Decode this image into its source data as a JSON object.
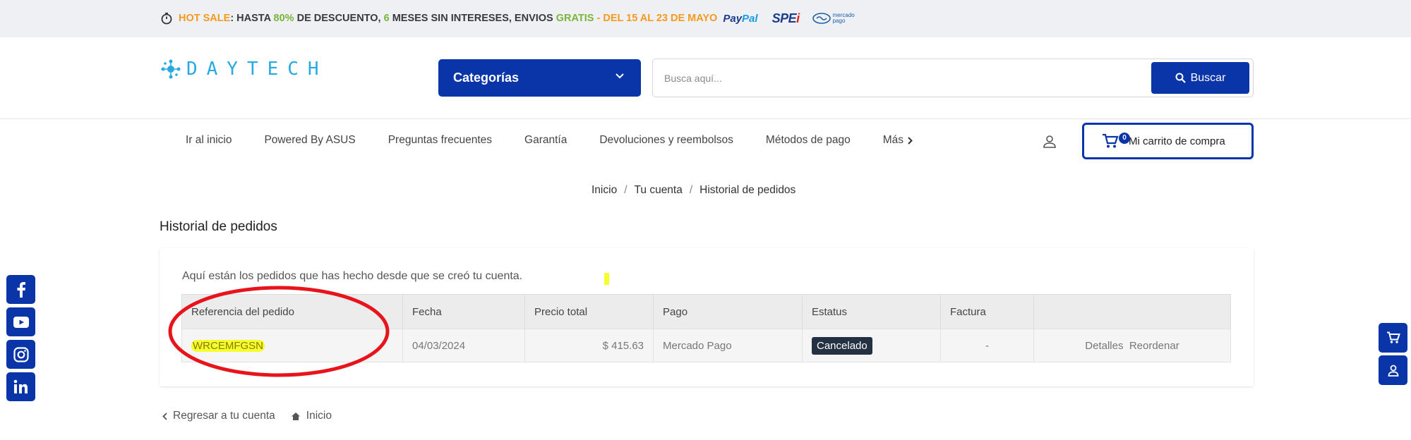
{
  "promo": {
    "hot_sale": "HOT SALE",
    "text1": ": HASTA ",
    "pct": "80%",
    "text2": " DE DESCUENTO, ",
    "months": "6",
    "text3": " MESES SIN INTERESES, ENVIOS ",
    "free": "GRATIS",
    "text4": " - ",
    "dates": "DEL 15 AL 23 DE MAYO",
    "paypal_a": "Pay",
    "paypal_b": "Pal",
    "spei": "SPE",
    "mp_line1": "mercado",
    "mp_line2": "pago"
  },
  "brand": {
    "logo_text": "DAYTECH"
  },
  "header": {
    "categories_label": "Categorías",
    "search_placeholder": "Busca aquí...",
    "search_button": "Buscar"
  },
  "nav": {
    "items": [
      "Ir al inicio",
      "Powered By ASUS",
      "Preguntas frecuentes",
      "Garantía",
      "Devoluciones y reembolsos",
      "Métodos de pago"
    ],
    "more": "Más"
  },
  "cart": {
    "count": "0",
    "label": "Mi carrito de compra"
  },
  "breadcrumb": [
    "Inicio",
    "Tu cuenta",
    "Historial de pedidos"
  ],
  "page": {
    "title": "Historial de pedidos",
    "intro": "Aquí están los pedidos que has hecho desde que se creó tu cuenta."
  },
  "orders": {
    "headers": [
      "Referencia del pedido",
      "Fecha",
      "Precio total",
      "Pago",
      "Estatus",
      "Factura",
      ""
    ],
    "rows": [
      {
        "reference": "WRCEMFGSN",
        "date": "04/03/2024",
        "total": "$ 415.63",
        "payment": "Mercado Pago",
        "status": "Cancelado",
        "invoice": "-",
        "details": "Detalles",
        "reorder": "Reordenar"
      }
    ]
  },
  "footer": {
    "back": "Regresar a tu cuenta",
    "home": "Inicio"
  },
  "colors": {
    "primary": "#0a35a8",
    "highlight": "#f6ff2e",
    "annotation": "#e8141c",
    "status_bg": "#233142"
  }
}
